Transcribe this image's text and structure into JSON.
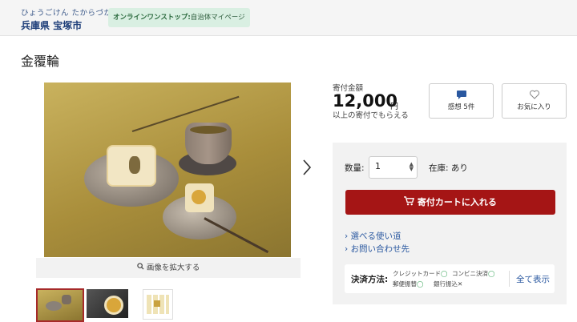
{
  "header": {
    "municipality_kana": "ひょうごけん たからづかし",
    "municipality_name": "兵庫県 宝塚市",
    "onestop_badge_bold": "オンラインワンストップ:",
    "onestop_badge_rest": "自治体マイページ"
  },
  "product": {
    "title": "金覆輪",
    "zoom_label": "画像を拡大する",
    "thumbnails": [
      "thumbnail-1",
      "thumbnail-2",
      "thumbnail-3"
    ]
  },
  "donation": {
    "label": "寄付金額",
    "amount": "12,000",
    "unit": "円",
    "sub": "以上の寄付でもらえる"
  },
  "actions": {
    "review_label": "感想 5件",
    "favorite_label": "お気に入り"
  },
  "purchase": {
    "quantity_label": "数量:",
    "quantity_value": "1",
    "stock_label": "在庫: あり",
    "cart_button": "寄付カートに入れる",
    "link_usage": "選べる使い道",
    "link_contact": "お問い合わせ先"
  },
  "payment": {
    "title": "決済方法:",
    "methods": [
      {
        "name": "クレジットカード",
        "status": "◯"
      },
      {
        "name": "コンビニ決済",
        "status": "◯"
      },
      {
        "name": "郵便振替",
        "status": "◯"
      },
      {
        "name": "銀行振込",
        "status": "✕"
      }
    ],
    "show_all": "全て表示"
  },
  "colors": {
    "cart_button": "#a51515",
    "link": "#2a58a0",
    "header_name": "#1f3f7a",
    "badge_bg": "#d9efe2"
  }
}
